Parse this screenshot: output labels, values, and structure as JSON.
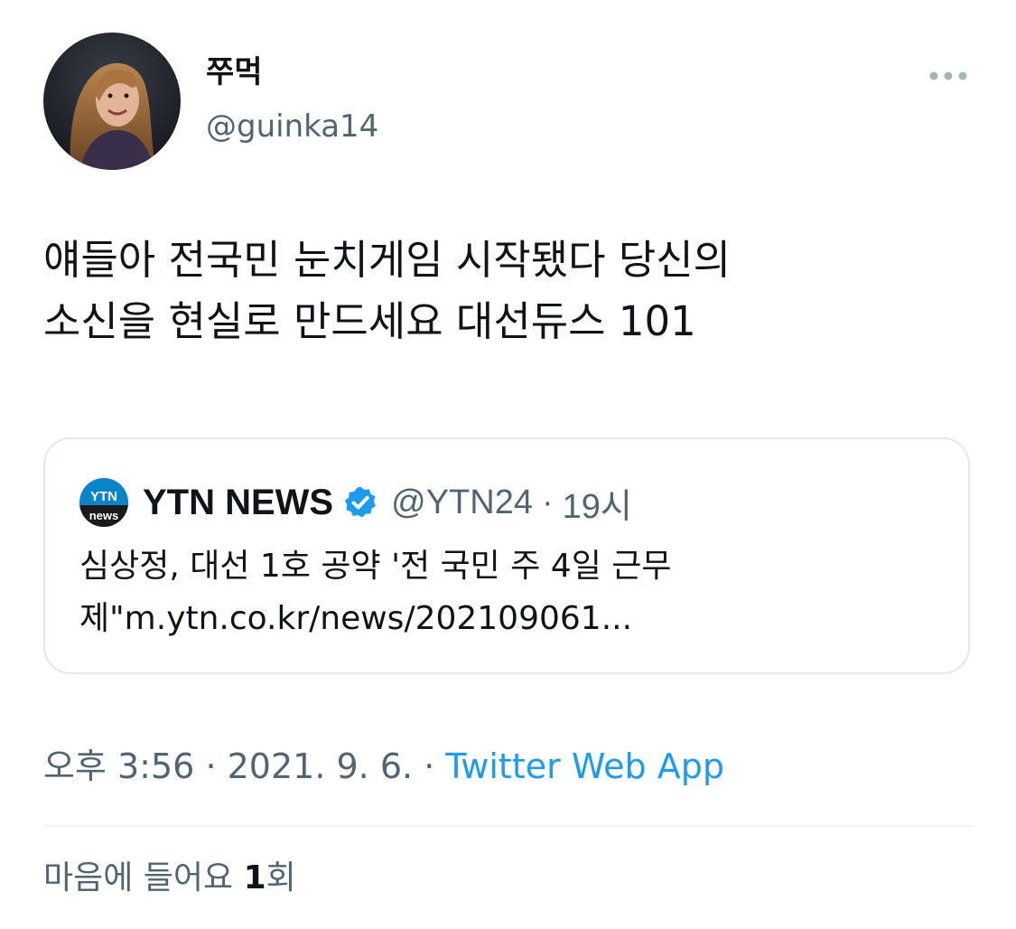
{
  "author": {
    "display_name": "쭈먹",
    "handle": "@guinka14",
    "avatar_icon": "profile-photo"
  },
  "more_icon": "more-dots-icon",
  "tweet": {
    "text": "얘들아 전국민 눈치게임 시작됐다 당신의\n소신을 현실로 만드세요 대선듀스 101"
  },
  "quoted_tweet": {
    "logo_text_top": "YTN",
    "logo_text_bottom": "news",
    "name": "YTN NEWS",
    "verified_icon": "verified-badge-icon",
    "handle": "@YTN24",
    "separator": "·",
    "time": "19시",
    "text": "심상정, 대선 1호 공약 '전 국민 주 4일 근무\n제\"m.ytn.co.kr/news/202109061..."
  },
  "meta": {
    "time": "오후 3:56",
    "separator": "·",
    "date": "2021. 9. 6.",
    "separator2": "·",
    "source": "Twitter Web App"
  },
  "likes": {
    "prefix": "마음에 들어요 ",
    "count": "1",
    "suffix": "회"
  },
  "colors": {
    "text": "#0f1419",
    "secondary": "#536471",
    "link": "#1d9bf0",
    "border": "#e3e8ec",
    "ytn_blue": "#0a84c8"
  }
}
